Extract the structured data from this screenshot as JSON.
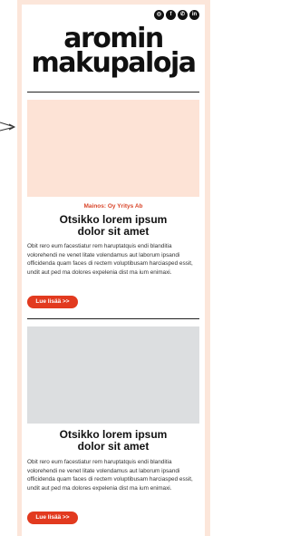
{
  "logo": {
    "line1": "aromin",
    "line2": "makupaloja"
  },
  "social": [
    {
      "icon": "instagram-icon",
      "glyph": "◎"
    },
    {
      "icon": "facebook-icon",
      "glyph": "f"
    },
    {
      "icon": "whatsapp-icon",
      "glyph": "✆"
    },
    {
      "icon": "linkedin-icon",
      "glyph": "in"
    }
  ],
  "article1": {
    "sponsor": "Mainos: Oy Yritys Ab",
    "title_line1": "Otsikko lorem ipsum",
    "title_line2": "dolor sit amet",
    "body": "Obit rero eum facestiatur rem haruptatquis endi blanditia volorehendi ne venet litate volendamus aut laborum ipsandi officidenda quam faces di rectem voluptibusam harciasped essit, undit aut ped ma dolores expelenia dist ma ium enimaxi.",
    "button": "Lue lisää >>",
    "image_color": "#fde3d6"
  },
  "article2": {
    "title_line1": "Otsikko lorem ipsum",
    "title_line2": "dolor sit amet",
    "body": "Obit rero eum facestiatur rem haruptatquis endi blanditia volorehendi ne venet litate volendamus aut laborum ipsandi officidenda quam faces di rectem voluptibusam harciasped essit, undit aut ped ma dolores expelenia dist ma ium enimaxi.",
    "button": "Lue lisää >>",
    "image_color": "#dcdee0"
  },
  "colors": {
    "accent": "#e23a1f",
    "background": "#fce6da"
  }
}
